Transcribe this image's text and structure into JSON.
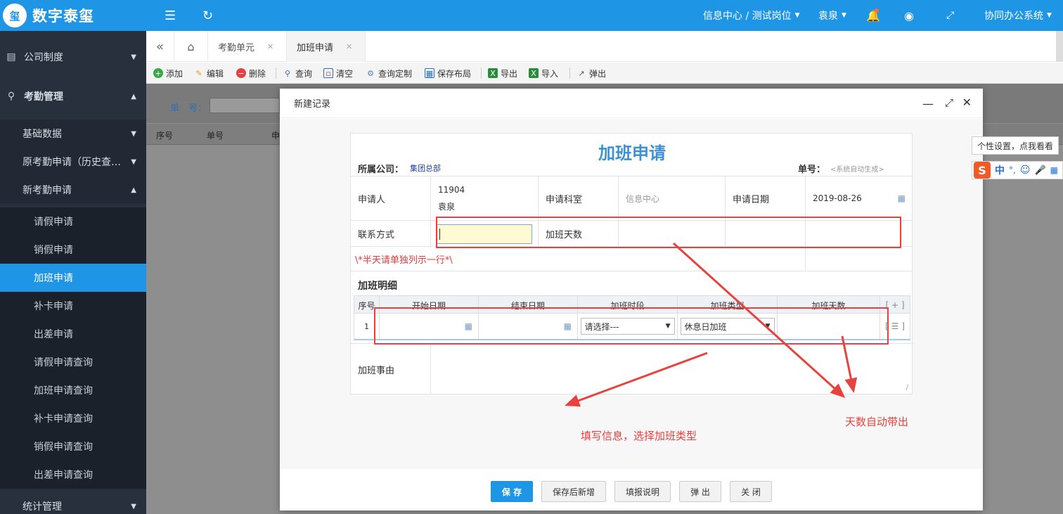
{
  "app": {
    "name": "数字泰玺",
    "logo_text": "玺"
  },
  "header": {
    "position": "信息中心 / 测试岗位",
    "user": "袁泉",
    "system": "协同办公系统"
  },
  "sidebar": {
    "items": [
      {
        "label": "公司制度",
        "icon": "document-icon"
      },
      {
        "label": "考勤管理",
        "icon": "location-pin-icon"
      },
      {
        "label": "基础数据"
      },
      {
        "label": "原考勤申请（历史查…"
      },
      {
        "label": "新考勤申请"
      },
      {
        "label": "请假申请"
      },
      {
        "label": "销假申请"
      },
      {
        "label": "加班申请"
      },
      {
        "label": "补卡申请"
      },
      {
        "label": "出差申请"
      },
      {
        "label": "请假申请查询"
      },
      {
        "label": "加班申请查询"
      },
      {
        "label": "补卡申请查询"
      },
      {
        "label": "销假申请查询"
      },
      {
        "label": "出差申请查询"
      },
      {
        "label": "统计管理"
      }
    ]
  },
  "tabs": [
    {
      "label": "考勤单元"
    },
    {
      "label": "加班申请"
    }
  ],
  "toolbar": {
    "add": "添加",
    "edit": "编辑",
    "delete": "删除",
    "query": "查询",
    "clear": "清空",
    "custom_query": "查询定制",
    "save_layout": "保存布局",
    "export": "导出",
    "import": "导入",
    "popup": "弹出"
  },
  "search": {
    "doc_label": "单　号：",
    "cols": [
      "序号",
      "单号",
      "申"
    ]
  },
  "dialog": {
    "title": "新建记录",
    "form_title": "加班申请",
    "company_label": "所属公司：",
    "company_value": "集团总部",
    "doc_no_label": "单号：",
    "doc_no_placeholder": "<系统自动生成>",
    "applicant_label": "申请人",
    "applicant_id": "11904",
    "applicant_name": "袁泉",
    "dept_label": "申请科室",
    "dept_value": "信息中心",
    "date_label": "申请日期",
    "date_value": "2019-08-26",
    "contact_label": "联系方式",
    "days_label": "加班天数",
    "note": "\\*半天请单独列示一行*\\",
    "detail_title": "加班明细",
    "detail_headers": [
      "序号",
      "开始日期",
      "结束日期",
      "加班时段",
      "加班类型",
      "加班天数"
    ],
    "add_row": "[ + ]",
    "row_menu": "[ ☰ ]",
    "row": {
      "no": "1",
      "period": "请选择---",
      "type": "休息日加班"
    },
    "reason_label": "加班事由"
  },
  "buttons": {
    "save": "保 存",
    "save_new": "保存后新增",
    "help": "填报说明",
    "popup": "弹 出",
    "close": "关 闭"
  },
  "annotations": {
    "left": "填写信息，选择加班类型",
    "right": "天数自动带出"
  },
  "ime": {
    "tooltip": "个性设置，点我看看",
    "mode": "中",
    "punct": "°,"
  }
}
